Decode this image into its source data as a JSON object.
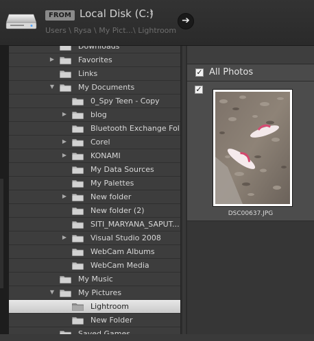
{
  "header": {
    "from_badge": "FROM",
    "source": "Local Disk (C:)",
    "source_chevron": "⇕",
    "breadcrumb": "Users \\ Rysa \\ My Pict...\\ Lightroom",
    "go_arrow": "➔"
  },
  "tree": [
    {
      "label": "Downloads",
      "expander": "",
      "level": 0
    },
    {
      "label": "Favorites",
      "expander": "collapsed",
      "level": 0
    },
    {
      "label": "Links",
      "expander": "",
      "level": 0
    },
    {
      "label": "My Documents",
      "expander": "expanded",
      "level": 0
    },
    {
      "label": "0_Spy Teen - Copy",
      "expander": "",
      "level": 1
    },
    {
      "label": "blog",
      "expander": "collapsed",
      "level": 1
    },
    {
      "label": "Bluetooth Exchange Fol...",
      "expander": "",
      "level": 1
    },
    {
      "label": "Corel",
      "expander": "collapsed",
      "level": 1
    },
    {
      "label": "KONAMI",
      "expander": "collapsed",
      "level": 1
    },
    {
      "label": "My Data Sources",
      "expander": "",
      "level": 1
    },
    {
      "label": "My Palettes",
      "expander": "",
      "level": 1
    },
    {
      "label": "New folder",
      "expander": "collapsed",
      "level": 1
    },
    {
      "label": "New folder (2)",
      "expander": "",
      "level": 1
    },
    {
      "label": "SITI_MARYANA_SAPUT...",
      "expander": "",
      "level": 1
    },
    {
      "label": "Visual Studio 2008",
      "expander": "collapsed",
      "level": 1
    },
    {
      "label": "WebCam Albums",
      "expander": "",
      "level": 1
    },
    {
      "label": "WebCam Media",
      "expander": "",
      "level": 1
    },
    {
      "label": "My Music",
      "expander": "",
      "level": 0
    },
    {
      "label": "My Pictures",
      "expander": "expanded",
      "level": 0
    },
    {
      "label": "Lightroom",
      "expander": "",
      "level": 1,
      "selected": true
    },
    {
      "label": "New Folder",
      "expander": "",
      "level": 1
    },
    {
      "label": "Saved Games",
      "expander": "",
      "level": 0
    }
  ],
  "photos": {
    "all_label": "All Photos",
    "all_checked": true,
    "items": [
      {
        "filename": "DSC00637.JPG",
        "checked": true
      }
    ]
  },
  "icons": {
    "disk": "hard-disk-icon",
    "folder": "folder-icon",
    "arrow": "arrow-right-icon",
    "expand": "triangle-right-icon",
    "collapse": "triangle-down-icon"
  },
  "colors": {
    "header_bg": "#2e2e2e",
    "panel_bg": "#3d3d3d",
    "selected_row": "#d8d8d8",
    "text": "#d8d8d8"
  }
}
